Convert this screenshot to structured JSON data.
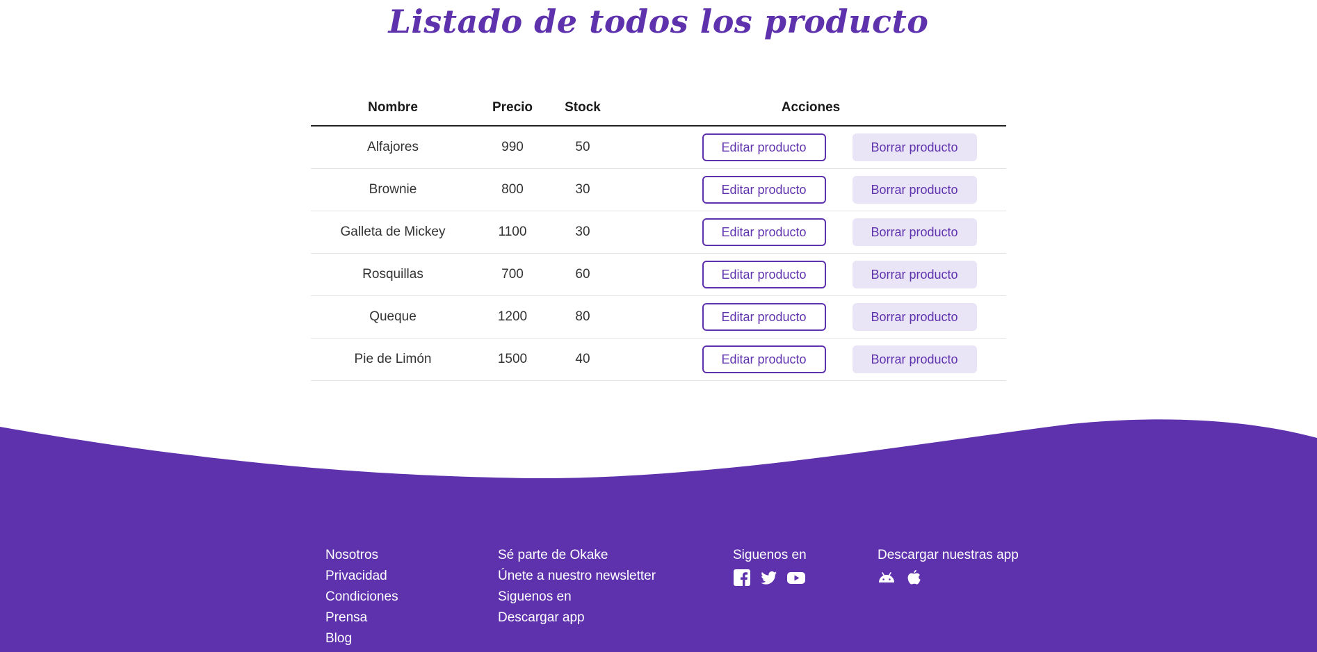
{
  "page": {
    "title": "Listado de todos los producto"
  },
  "table": {
    "headers": {
      "name": "Nombre",
      "price": "Precio",
      "stock": "Stock",
      "actions": "Acciones"
    },
    "rows": [
      {
        "name": "Alfajores",
        "price": "990",
        "stock": "50"
      },
      {
        "name": "Brownie",
        "price": "800",
        "stock": "30"
      },
      {
        "name": "Galleta de Mickey",
        "price": "1100",
        "stock": "30"
      },
      {
        "name": "Rosquillas",
        "price": "700",
        "stock": "60"
      },
      {
        "name": "Queque",
        "price": "1200",
        "stock": "80"
      },
      {
        "name": "Pie de Limón",
        "price": "1500",
        "stock": "40"
      }
    ],
    "edit_label": "Editar producto",
    "delete_label": "Borrar producto"
  },
  "footer": {
    "col1": [
      "Nosotros",
      "Privacidad",
      "Condiciones",
      "Prensa",
      "Blog"
    ],
    "col2": [
      "Sé parte de Okake",
      "Únete a nuestro newsletter",
      "Siguenos en",
      "Descargar app"
    ],
    "social_heading": "Siguenos en",
    "social_icons": [
      "facebook-icon",
      "twitter-icon",
      "youtube-icon"
    ],
    "app_heading": "Descargar nuestras app",
    "app_icons": [
      "android-icon",
      "apple-icon"
    ]
  },
  "colors": {
    "brand": "#5f32ad",
    "delete_button_bg": "#e9e5f7"
  }
}
